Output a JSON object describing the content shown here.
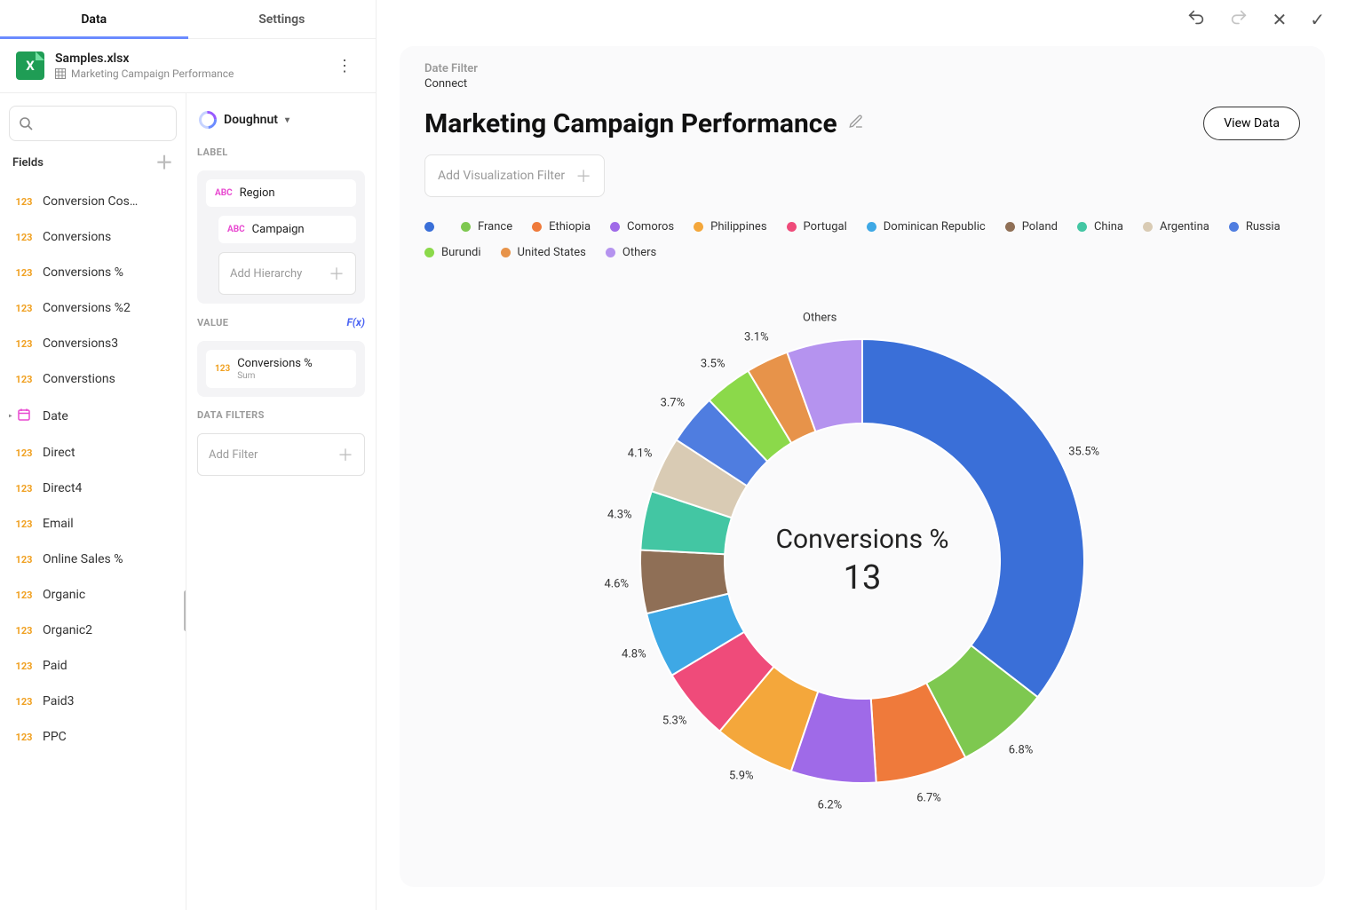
{
  "tabs": {
    "data": "Data",
    "settings": "Settings"
  },
  "source": {
    "file": "Samples.xlsx",
    "sheet": "Marketing Campaign Performance"
  },
  "fields_header": "Fields",
  "fields": [
    {
      "type": "123",
      "name": "Conversion Cos…"
    },
    {
      "type": "123",
      "name": "Conversions"
    },
    {
      "type": "123",
      "name": "Conversions %"
    },
    {
      "type": "123",
      "name": "Conversions %2"
    },
    {
      "type": "123",
      "name": "Conversions3"
    },
    {
      "type": "123",
      "name": "Converstions"
    },
    {
      "type": "date",
      "name": "Date",
      "expandable": true
    },
    {
      "type": "123",
      "name": "Direct"
    },
    {
      "type": "123",
      "name": "Direct4"
    },
    {
      "type": "123",
      "name": "Email"
    },
    {
      "type": "123",
      "name": "Online Sales %"
    },
    {
      "type": "123",
      "name": "Organic"
    },
    {
      "type": "123",
      "name": "Organic2"
    },
    {
      "type": "123",
      "name": "Paid"
    },
    {
      "type": "123",
      "name": "Paid3"
    },
    {
      "type": "123",
      "name": "PPC"
    }
  ],
  "config": {
    "chart_type": "Doughnut",
    "sections": {
      "label": "LABEL",
      "value": "VALUE",
      "data_filters": "DATA FILTERS"
    },
    "fx": "F(x)",
    "label_pills": [
      {
        "type": "ABC",
        "name": "Region"
      },
      {
        "type": "ABC",
        "name": "Campaign"
      }
    ],
    "add_hierarchy": "Add Hierarchy",
    "value_pill": {
      "type": "123",
      "name": "Conversions %",
      "agg": "Sum"
    },
    "add_filter": "Add Filter"
  },
  "topbar": {},
  "breadcrumb": {
    "a": "Date Filter",
    "b": "Connect"
  },
  "title": "Marketing Campaign Performance",
  "view_data": "View Data",
  "vis_filter": "Add Visualization Filter",
  "center": {
    "label": "Conversions %",
    "value": "13"
  },
  "legend": [
    {
      "name": "",
      "color": "#3a6fd8",
      "value": 35.5,
      "showLabel": "35.5%",
      "labelOverride": null
    },
    {
      "name": "France",
      "color": "#7ec850",
      "value": 6.8,
      "showLabel": "6.8%"
    },
    {
      "name": "Ethiopia",
      "color": "#ef7a3b",
      "value": 6.7,
      "showLabel": "6.7%"
    },
    {
      "name": "Comoros",
      "color": "#9f6ae8",
      "value": 6.2,
      "showLabel": "6.2%"
    },
    {
      "name": "Philippines",
      "color": "#f4a73b",
      "value": 5.9,
      "showLabel": "5.9%"
    },
    {
      "name": "Portugal",
      "color": "#ef4b7a",
      "value": 5.3,
      "showLabel": "5.3%"
    },
    {
      "name": "Dominican Republic",
      "color": "#3ea8e5",
      "value": 4.8,
      "showLabel": "4.8%"
    },
    {
      "name": "Poland",
      "color": "#8f6f56",
      "value": 4.6,
      "showLabel": "4.6%"
    },
    {
      "name": "China",
      "color": "#43c6a3",
      "value": 4.3,
      "showLabel": "4.3%"
    },
    {
      "name": "Argentina",
      "color": "#d9cbb4",
      "value": 4.1,
      "showLabel": "4.1%"
    },
    {
      "name": "Russia",
      "color": "#4f7de0",
      "value": 3.7,
      "showLabel": "3.7%"
    },
    {
      "name": "Burundi",
      "color": "#8bd94a",
      "value": 3.5,
      "showLabel": "3.5%"
    },
    {
      "name": "United States",
      "color": "#e7934a",
      "value": 3.1,
      "showLabel": "3.1%"
    },
    {
      "name": "Others",
      "color": "#b593ef",
      "value": 5.5,
      "showLabel": "Others"
    }
  ],
  "chart_data": {
    "type": "pie",
    "title": "Marketing Campaign Performance",
    "center_metric": "Conversions %",
    "center_value": 13,
    "series": [
      {
        "name": "",
        "value": 35.5
      },
      {
        "name": "France",
        "value": 6.8
      },
      {
        "name": "Ethiopia",
        "value": 6.7
      },
      {
        "name": "Comoros",
        "value": 6.2
      },
      {
        "name": "Philippines",
        "value": 5.9
      },
      {
        "name": "Portugal",
        "value": 5.3
      },
      {
        "name": "Dominican Republic",
        "value": 4.8
      },
      {
        "name": "Poland",
        "value": 4.6
      },
      {
        "name": "China",
        "value": 4.3
      },
      {
        "name": "Argentina",
        "value": 4.1
      },
      {
        "name": "Russia",
        "value": 3.7
      },
      {
        "name": "Burundi",
        "value": 3.5
      },
      {
        "name": "United States",
        "value": 3.1
      },
      {
        "name": "Others",
        "value": 5.5
      }
    ]
  }
}
